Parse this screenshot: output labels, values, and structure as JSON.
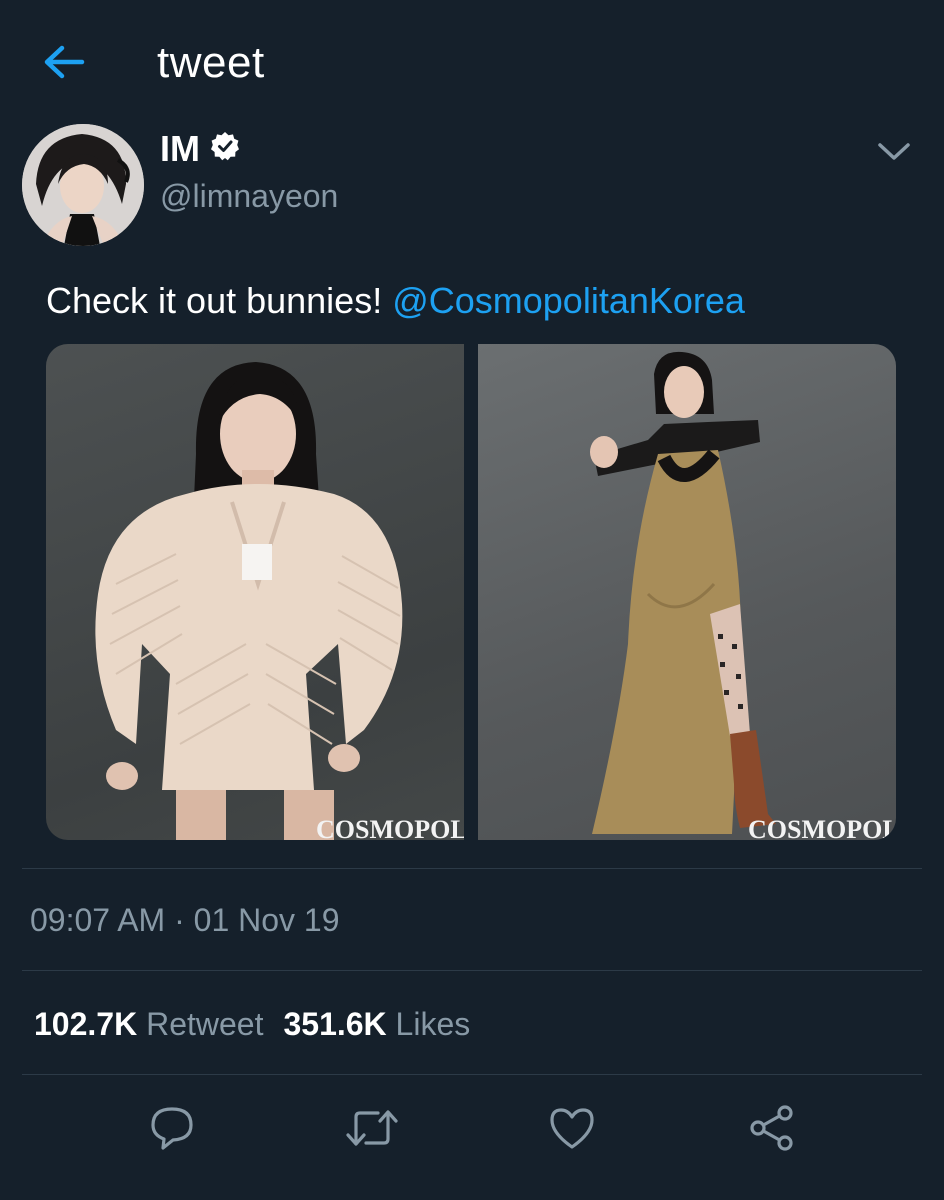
{
  "header": {
    "title": "tweet",
    "back_icon": "arrow-left-icon"
  },
  "author": {
    "display_name": "IM",
    "handle": "@limnayeon",
    "verified_icon": "verified-badge-icon"
  },
  "tweet": {
    "text": "Check it out bunnies! ",
    "mention": "@CosmopolitanKorea",
    "media": [
      {
        "watermark": "COSMOPOLITAN"
      },
      {
        "watermark": "COSMOPOLITAN"
      }
    ],
    "timestamp": "09:07 AM · 01 Nov 19"
  },
  "stats": {
    "retweets_count": "102.7K",
    "retweets_label": "Retweet",
    "likes_count": "351.6K",
    "likes_label": "Likes"
  },
  "actions": [
    "reply-icon",
    "retweet-icon",
    "like-icon",
    "share-icon"
  ],
  "colors": {
    "background": "#15202b",
    "accent": "#1da1f2",
    "secondary_text": "#8899a6",
    "divider": "#2c3a47"
  }
}
